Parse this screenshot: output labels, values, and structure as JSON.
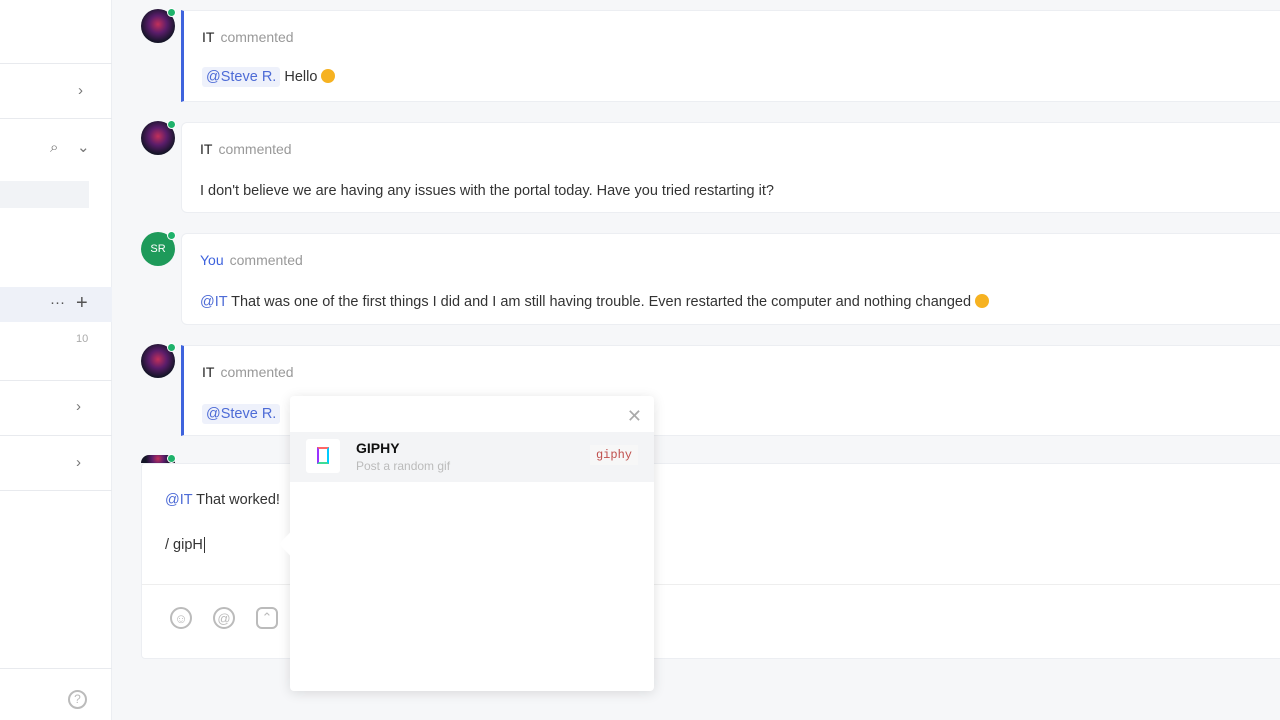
{
  "sidebar": {
    "count": "10"
  },
  "comments": [
    {
      "author": "IT",
      "action": "commented",
      "mention": "@Steve R.",
      "text": "Hello"
    },
    {
      "author": "IT",
      "action": "commented",
      "text": "I don't believe we are having any issues with the portal today. Have you tried restarting it?"
    },
    {
      "author": "You",
      "avatar": "SR",
      "action": "commented",
      "mention": "@IT",
      "text": "That was one of the first things I did and I am still having trouble. Even restarted the computer and nothing changed"
    },
    {
      "author": "IT",
      "action": "commented",
      "mention": "@Steve R."
    }
  ],
  "composer": {
    "mention": "@IT",
    "line1": "That worked!",
    "line2": "/ gipH"
  },
  "popup": {
    "title": "GIPHY",
    "subtitle": "Post a random gif",
    "command": "giphy"
  },
  "colors": {
    "accent": "#3e63dd",
    "online": "#1fb26b"
  }
}
